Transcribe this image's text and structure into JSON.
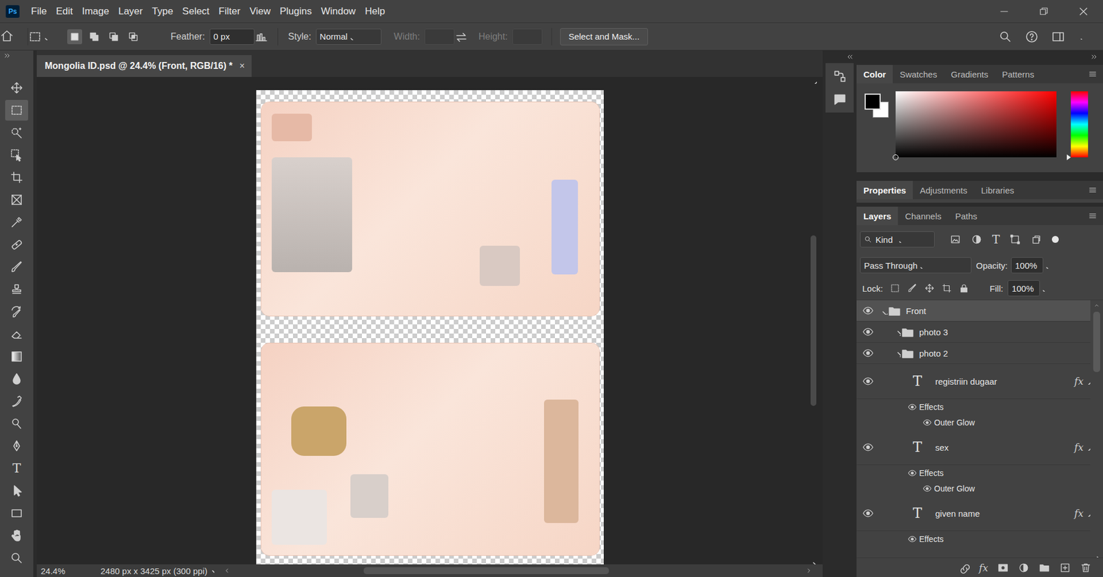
{
  "app": {
    "logo": "Ps",
    "menu": [
      "File",
      "Edit",
      "Image",
      "Layer",
      "Type",
      "Select",
      "Filter",
      "View",
      "Plugins",
      "Window",
      "Help"
    ]
  },
  "options_bar": {
    "mode_buttons": [
      {
        "selected": true
      },
      {
        "selected": false
      },
      {
        "selected": false
      },
      {
        "selected": false
      }
    ],
    "feather_label": "Feather:",
    "feather_value": "0 px",
    "style_label": "Style:",
    "style_value": "Normal",
    "width_label": "Width:",
    "height_label": "Height:",
    "mask_button": "Select and Mask..."
  },
  "document_tab": {
    "title": "Mongolia ID.psd @ 24.4% (Front, RGB/16) *",
    "close": "×"
  },
  "tools": [
    {
      "kind": "move",
      "selected": false
    },
    {
      "kind": "marquee",
      "selected": true
    },
    {
      "kind": "quickselect",
      "selected": false
    },
    {
      "kind": "objectselect",
      "selected": false
    },
    {
      "kind": "crop",
      "selected": false
    },
    {
      "kind": "frame",
      "selected": false
    },
    {
      "kind": "eyedropper",
      "selected": false
    },
    {
      "kind": "healing",
      "selected": false
    },
    {
      "kind": "brush",
      "selected": false
    },
    {
      "kind": "stamp",
      "selected": false
    },
    {
      "kind": "historybrush",
      "selected": false
    },
    {
      "kind": "eraser",
      "selected": false
    },
    {
      "kind": "gradient",
      "selected": false
    },
    {
      "kind": "blur",
      "selected": false
    },
    {
      "kind": "smudge",
      "selected": false
    },
    {
      "kind": "dodge",
      "selected": false
    },
    {
      "kind": "pen",
      "selected": false
    },
    {
      "kind": "type",
      "glyph": "T",
      "selected": false
    },
    {
      "kind": "pathselect",
      "selected": false
    },
    {
      "kind": "rectangle",
      "selected": false
    },
    {
      "kind": "hand",
      "selected": false
    },
    {
      "kind": "zoom",
      "selected": false
    }
  ],
  "canvas": {
    "vertical_scroll": {
      "level": 0.36
    },
    "horizontal_scroll": {
      "level": 0.43
    }
  },
  "status_bar": {
    "zoom": "24.4%",
    "size": "2480 px x 3425 px (300 ppi)"
  },
  "color_panel": {
    "tabs": [
      {
        "label": "Color",
        "selected": true
      },
      {
        "label": "Swatches",
        "selected": false
      },
      {
        "label": "Gradients",
        "selected": false
      },
      {
        "label": "Patterns",
        "selected": false
      }
    ]
  },
  "properties_panel": {
    "tabs": [
      {
        "label": "Properties",
        "selected": true
      },
      {
        "label": "Adjustments",
        "selected": false
      },
      {
        "label": "Libraries",
        "selected": false
      }
    ]
  },
  "layers_panel": {
    "tabs": [
      {
        "label": "Layers",
        "selected": true
      },
      {
        "label": "Channels",
        "selected": false
      },
      {
        "label": "Paths",
        "selected": false
      }
    ],
    "filter": "Kind",
    "type_glyph": "T",
    "blend_mode": "Pass Through",
    "opacity_label": "Opacity:",
    "opacity": "100%",
    "lock_label": "Lock:",
    "fill_label": "Fill:",
    "fill": "100%",
    "fx_button": "fx",
    "scroll": {
      "level": 0.25
    },
    "layers": [
      {
        "kind": "group",
        "name": "Front",
        "visible": true,
        "expanded": true,
        "selected": true,
        "depth": 0
      },
      {
        "kind": "group",
        "name": "photo 3",
        "visible": true,
        "expanded": false,
        "selected": false,
        "depth": 1
      },
      {
        "kind": "group",
        "name": "photo 2",
        "visible": true,
        "expanded": false,
        "selected": false,
        "depth": 1
      },
      {
        "kind": "text",
        "name": "registriin dugaar",
        "visible": true,
        "fx": "fx",
        "selected": false
      },
      {
        "kind": "effects",
        "name": "Effects",
        "visible": true
      },
      {
        "kind": "effect",
        "name": "Outer Glow",
        "visible": true
      },
      {
        "kind": "text",
        "name": "sex",
        "visible": true,
        "fx": "fx",
        "selected": false
      },
      {
        "kind": "effects",
        "name": "Effects",
        "visible": true
      },
      {
        "kind": "effect",
        "name": "Outer Glow",
        "visible": true
      },
      {
        "kind": "text",
        "name": "given name",
        "visible": true,
        "fx": "fx",
        "selected": false
      },
      {
        "kind": "effects",
        "name": "Effects",
        "visible": true
      }
    ]
  }
}
